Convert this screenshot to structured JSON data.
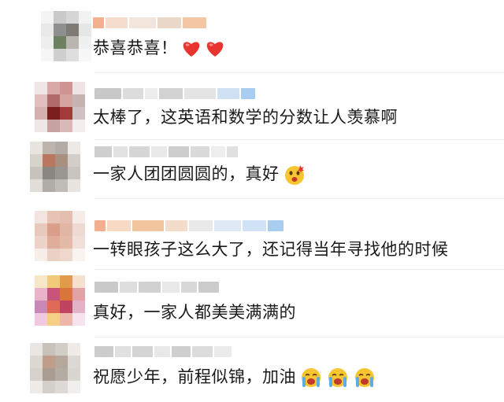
{
  "comments": [
    {
      "text": "恭喜恭喜！",
      "emojis": [
        "heart-icon",
        "heart-icon"
      ]
    },
    {
      "text": "太棒了，这英语和数学的分数让人羡慕啊",
      "emojis": []
    },
    {
      "text": "一家人团团圆圆的，真好",
      "emojis": [
        "surprised-face-icon"
      ]
    },
    {
      "text": "一转眼孩子这么大了，还记得当年寻找他的时候",
      "emojis": []
    },
    {
      "text": "真好，一家人都美美满满的",
      "emojis": []
    },
    {
      "text": "祝愿少年，前程似锦，加油",
      "emojis": [
        "crying-face-icon",
        "crying-face-icon",
        "crying-face-icon"
      ]
    }
  ],
  "colors": {
    "heart": "#e8352f",
    "emoji_face": "#f7c531",
    "divider": "#ececec",
    "text": "#1a1a1a"
  }
}
